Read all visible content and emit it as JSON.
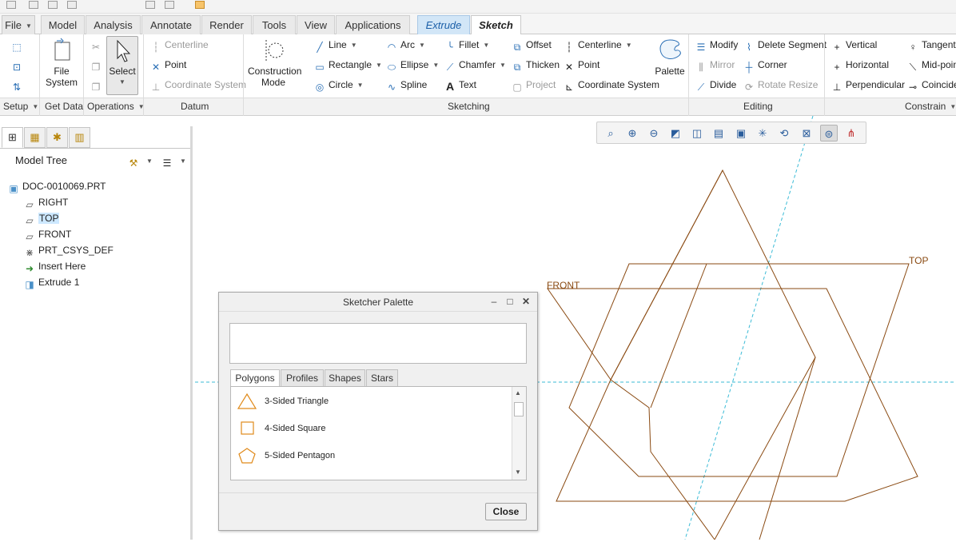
{
  "tabs": {
    "file": "File",
    "items": [
      "Model",
      "Analysis",
      "Annotate",
      "Render",
      "Tools",
      "View",
      "Applications"
    ],
    "extrude": "Extrude",
    "sketch": "Sketch"
  },
  "ribbon": {
    "setup_label": "Setup",
    "getdata": {
      "file_system": "File System",
      "label": "Get Data"
    },
    "operations": {
      "select": "Select",
      "label": "Operations"
    },
    "datum": {
      "centerline": "Centerline",
      "point": "Point",
      "csys": "Coordinate System",
      "label": "Datum"
    },
    "construction_mode": "Construction Mode",
    "sketching": {
      "line": "Line",
      "rectangle": "Rectangle",
      "circle": "Circle",
      "arc": "Arc",
      "ellipse": "Ellipse",
      "spline": "Spline",
      "fillet": "Fillet",
      "chamfer": "Chamfer",
      "text": "Text",
      "offset": "Offset",
      "thicken": "Thicken",
      "project": "Project",
      "centerline": "Centerline",
      "point": "Point",
      "csys": "Coordinate System",
      "palette": "Palette",
      "label": "Sketching"
    },
    "editing": {
      "modify": "Modify",
      "mirror": "Mirror",
      "divide": "Divide",
      "delete_segment": "Delete Segment",
      "corner": "Corner",
      "rotate_resize": "Rotate Resize",
      "label": "Editing"
    },
    "constrain": {
      "vertical": "Vertical",
      "horizontal": "Horizontal",
      "perpendicular": "Perpendicular",
      "tangent": "Tangent",
      "midpoint": "Mid-point",
      "coincident": "Coincide",
      "label": "Constrain"
    }
  },
  "model_tree": {
    "title": "Model Tree",
    "nodes": [
      {
        "label": "DOC-0010069.PRT"
      },
      {
        "label": "RIGHT"
      },
      {
        "label": "TOP"
      },
      {
        "label": "FRONT"
      },
      {
        "label": "PRT_CSYS_DEF"
      },
      {
        "label": "Insert Here"
      },
      {
        "label": "Extrude 1"
      }
    ],
    "selected": "TOP"
  },
  "canvas": {
    "top_label": "TOP",
    "front_label": "FRONT",
    "sketch_color": "#8a4a12",
    "centerline_color": "#3bbbd6"
  },
  "palette": {
    "title": "Sketcher Palette",
    "tabs": [
      "Polygons",
      "Profiles",
      "Shapes",
      "Stars"
    ],
    "active_tab": "Polygons",
    "items": [
      "3-Sided Triangle",
      "4-Sided Square",
      "5-Sided Pentagon"
    ],
    "close_label": "Close",
    "icon_color": "#e08a1a"
  }
}
